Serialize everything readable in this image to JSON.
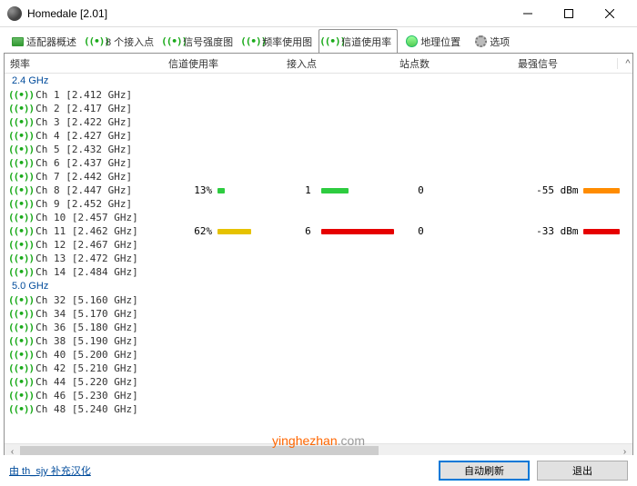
{
  "window": {
    "title": "Homedale [2.01]"
  },
  "tabs": [
    {
      "label": "适配器概述"
    },
    {
      "label": "8 个接入点"
    },
    {
      "label": "信号强度图"
    },
    {
      "label": "频率使用图"
    },
    {
      "label": "信道使用率"
    },
    {
      "label": "地理位置"
    },
    {
      "label": "选项"
    }
  ],
  "columns": {
    "freq": "频率",
    "usage": "信道使用率",
    "ap": "接入点",
    "sta": "站点数",
    "signal": "最强信号"
  },
  "sections": {
    "band24": "2.4 GHz",
    "band50": "5.0 GHz"
  },
  "rows24": [
    {
      "ch": "Ch 1 [2.412 GHz]"
    },
    {
      "ch": "Ch 2 [2.417 GHz]"
    },
    {
      "ch": "Ch 3 [2.422 GHz]"
    },
    {
      "ch": "Ch 4 [2.427 GHz]"
    },
    {
      "ch": "Ch 5 [2.432 GHz]"
    },
    {
      "ch": "Ch 6 [2.437 GHz]"
    },
    {
      "ch": "Ch 7 [2.442 GHz]"
    },
    {
      "ch": "Ch 8 [2.447 GHz]",
      "usage_pct": "13%",
      "usage_bar": 13,
      "usage_color": "#2ecc40",
      "ap": "1",
      "ap_bar": 30,
      "ap_color": "#2ecc40",
      "sta": "0",
      "signal": "-55 dBm",
      "sig_color": "#ff8c00"
    },
    {
      "ch": "Ch 9 [2.452 GHz]"
    },
    {
      "ch": "Ch 10 [2.457 GHz]"
    },
    {
      "ch": "Ch 11 [2.462 GHz]",
      "usage_pct": "62%",
      "usage_bar": 62,
      "usage_color": "#e6c200",
      "ap": "6",
      "ap_bar": 80,
      "ap_color": "#e60000",
      "sta": "0",
      "signal": "-33 dBm",
      "sig_color": "#e60000"
    },
    {
      "ch": "Ch 12 [2.467 GHz]"
    },
    {
      "ch": "Ch 13 [2.472 GHz]"
    },
    {
      "ch": "Ch 14 [2.484 GHz]"
    }
  ],
  "rows50": [
    {
      "ch": "Ch 32 [5.160 GHz]"
    },
    {
      "ch": "Ch 34 [5.170 GHz]"
    },
    {
      "ch": "Ch 36 [5.180 GHz]"
    },
    {
      "ch": "Ch 38 [5.190 GHz]"
    },
    {
      "ch": "Ch 40 [5.200 GHz]"
    },
    {
      "ch": "Ch 42 [5.210 GHz]"
    },
    {
      "ch": "Ch 44 [5.220 GHz]"
    },
    {
      "ch": "Ch 46 [5.230 GHz]"
    },
    {
      "ch": "Ch 48 [5.240 GHz]"
    }
  ],
  "footer": {
    "link": "由 th_sjy 补充汉化",
    "refresh": "自动刷新",
    "exit": "退出"
  },
  "watermark": {
    "a": "yinghezhan",
    "b": ".com"
  },
  "chart_data": {
    "type": "table",
    "title": "信道使用率",
    "columns": [
      "频率",
      "信道使用率",
      "接入点",
      "站点数",
      "最强信号"
    ],
    "series": [
      {
        "band": "2.4 GHz",
        "channel": 8,
        "freq_ghz": 2.447,
        "usage_pct": 13,
        "access_points": 1,
        "stations": 0,
        "strongest_signal_dbm": -55
      },
      {
        "band": "2.4 GHz",
        "channel": 11,
        "freq_ghz": 2.462,
        "usage_pct": 62,
        "access_points": 6,
        "stations": 0,
        "strongest_signal_dbm": -33
      }
    ]
  }
}
